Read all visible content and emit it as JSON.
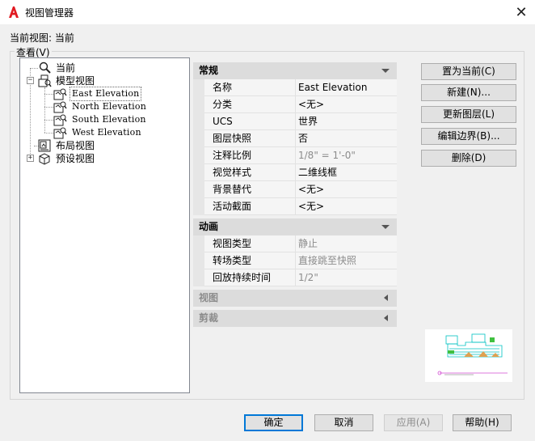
{
  "window": {
    "title": "视图管理器",
    "close_glyph": "✕"
  },
  "current_view": {
    "label": "当前视图: 当前"
  },
  "group": {
    "label": "查看(V)"
  },
  "tree": {
    "items": [
      {
        "label": "当前",
        "icon": "magnifier-icon"
      },
      {
        "label": "模型视图",
        "icon": "model-views-icon",
        "expander": "−"
      },
      {
        "label": "East Elevation",
        "icon": "named-view-icon"
      },
      {
        "label": "North Elevation",
        "icon": "named-view-icon"
      },
      {
        "label": "South Elevation",
        "icon": "named-view-icon"
      },
      {
        "label": "West Elevation",
        "icon": "named-view-icon"
      },
      {
        "label": "布局视图",
        "icon": "layout-views-icon"
      },
      {
        "label": "预设视图",
        "icon": "preset-views-icon",
        "expander": "+"
      }
    ]
  },
  "properties": {
    "general": {
      "title": "常规",
      "rows": [
        {
          "name": "名称",
          "value": "East Elevation"
        },
        {
          "name": "分类",
          "value": "<无>"
        },
        {
          "name": "UCS",
          "value": "世界"
        },
        {
          "name": "图层快照",
          "value": "否"
        },
        {
          "name": "注释比例",
          "value": "1/8\" = 1'-0\""
        },
        {
          "name": "视觉样式",
          "value": "二维线框"
        },
        {
          "name": "背景替代",
          "value": "<无>"
        },
        {
          "name": "活动截面",
          "value": "<无>"
        }
      ]
    },
    "animation": {
      "title": "动画",
      "rows": [
        {
          "name": "视图类型",
          "value": "静止"
        },
        {
          "name": "转场类型",
          "value": "直接跳至快照"
        },
        {
          "name": "回放持续时间",
          "value": "1/2\""
        }
      ]
    },
    "view": {
      "title": "视图"
    },
    "clip": {
      "title": "剪裁"
    }
  },
  "buttons": {
    "set_current": "置为当前(C)",
    "new": "新建(N)...",
    "update_layers": "更新图层(L)",
    "edit_boundaries": "编辑边界(B)...",
    "delete": "删除(D)",
    "ok": "确定",
    "cancel": "取消",
    "apply": "应用(A)",
    "help": "帮助(H)"
  },
  "colors": {
    "accent": "#0078d7",
    "logo": "#e11b22",
    "preview_cyan": "#00c2c2",
    "preview_magenta": "#d24cd2"
  }
}
